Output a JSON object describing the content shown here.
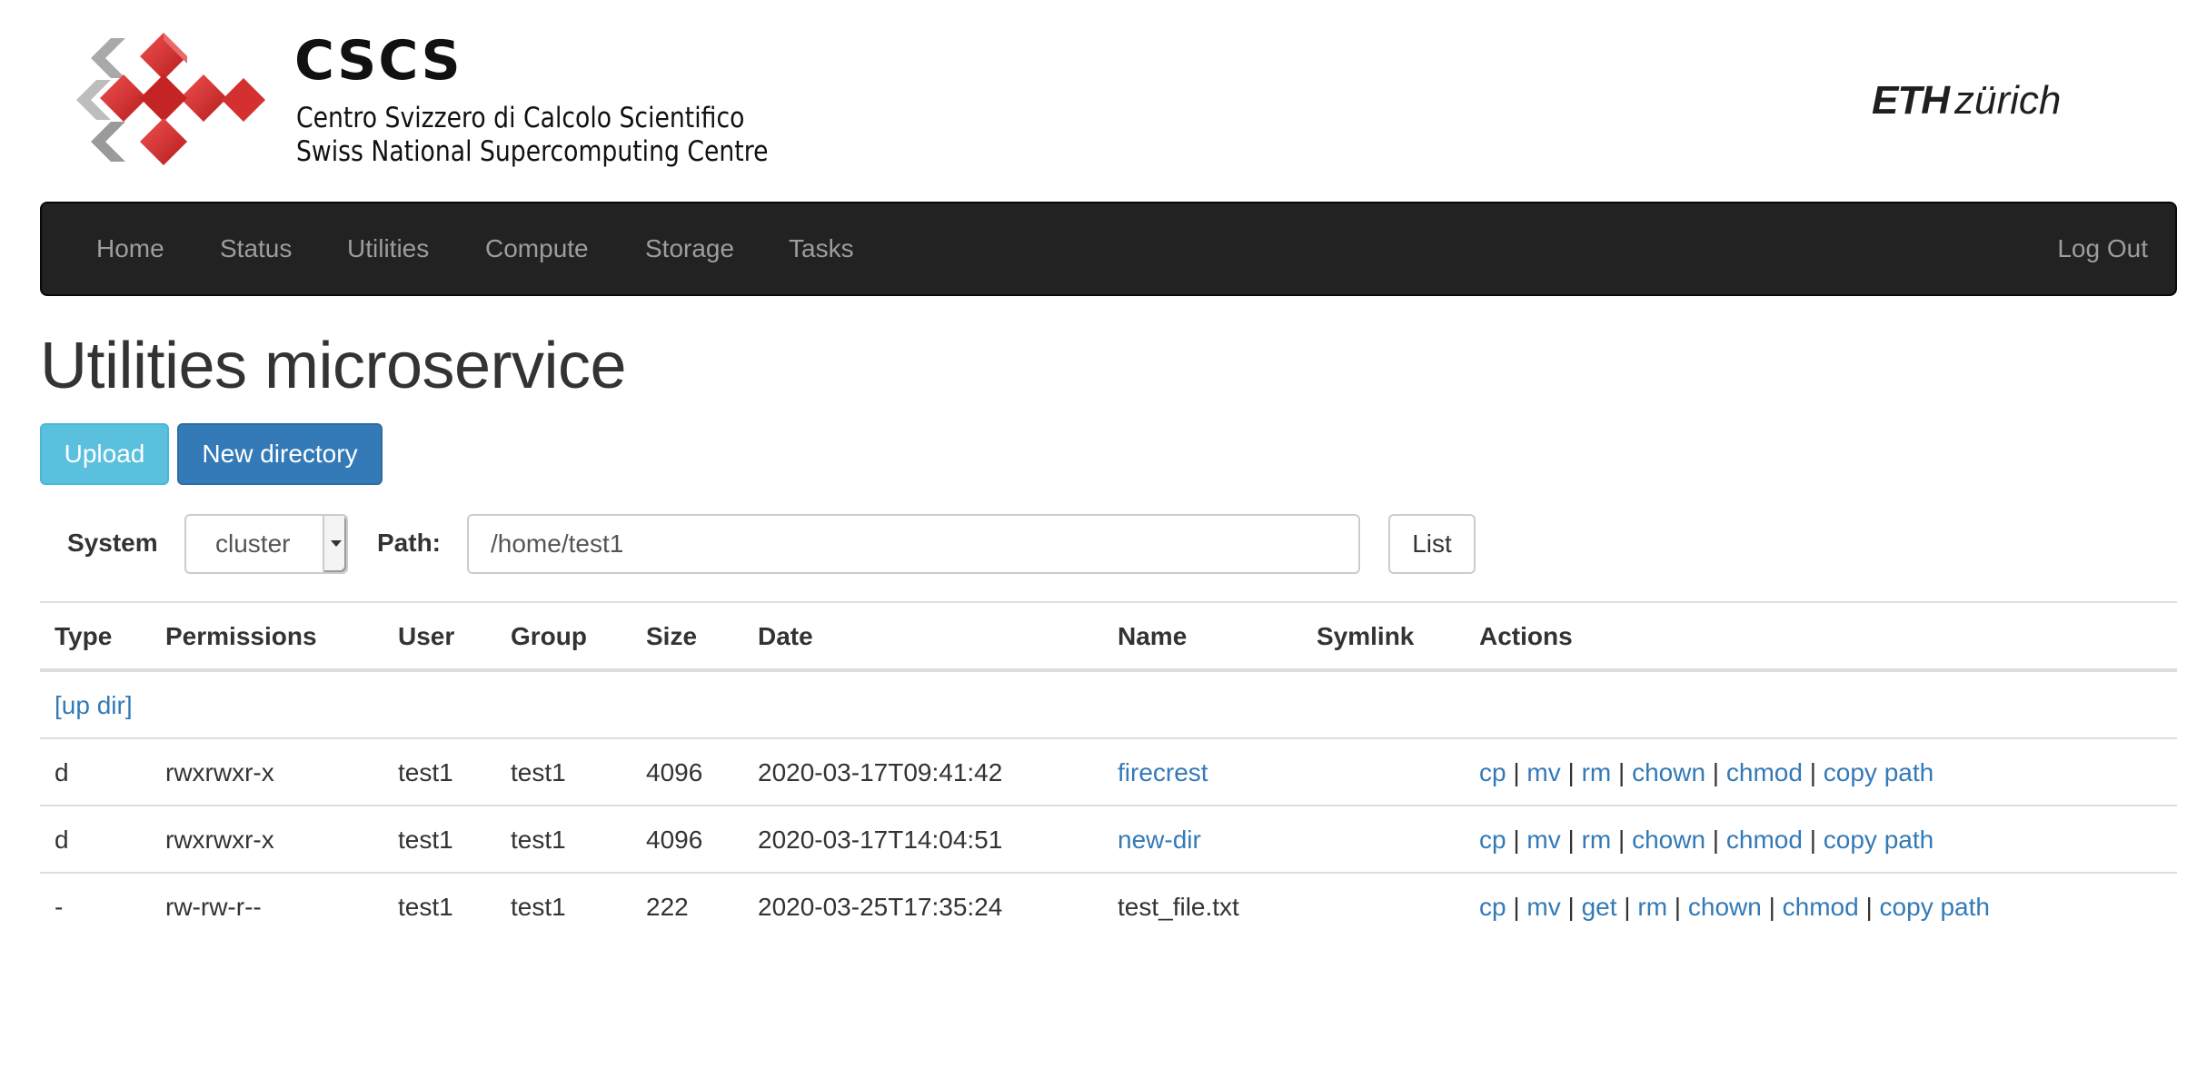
{
  "header": {
    "logo_title": "CSCS",
    "logo_line1": "Centro Svizzero di Calcolo Scientifico",
    "logo_line2": "Swiss National Supercomputing Centre",
    "eth_bold": "ETH",
    "eth_light": "zürich"
  },
  "nav": {
    "items": [
      "Home",
      "Status",
      "Utilities",
      "Compute",
      "Storage",
      "Tasks"
    ],
    "logout": "Log Out"
  },
  "page_title": "Utilities microservice",
  "buttons": {
    "upload": "Upload",
    "new_directory": "New directory",
    "list": "List"
  },
  "form": {
    "system_label": "System",
    "system_value": "cluster",
    "path_label": "Path:",
    "path_value": "/home/test1"
  },
  "table": {
    "headers": [
      "Type",
      "Permissions",
      "User",
      "Group",
      "Size",
      "Date",
      "Name",
      "Symlink",
      "Actions"
    ],
    "up_dir": "[up dir]",
    "rows": [
      {
        "type": "d",
        "permissions": "rwxrwxr-x",
        "user": "test1",
        "group": "test1",
        "size": "4096",
        "date": "2020-03-17T09:41:42",
        "name": "firecrest",
        "name_is_link": true,
        "symlink": "",
        "actions": [
          "cp",
          "mv",
          "rm",
          "chown",
          "chmod",
          "copy path"
        ]
      },
      {
        "type": "d",
        "permissions": "rwxrwxr-x",
        "user": "test1",
        "group": "test1",
        "size": "4096",
        "date": "2020-03-17T14:04:51",
        "name": "new-dir",
        "name_is_link": true,
        "symlink": "",
        "actions": [
          "cp",
          "mv",
          "rm",
          "chown",
          "chmod",
          "copy path"
        ]
      },
      {
        "type": "-",
        "permissions": "rw-rw-r--",
        "user": "test1",
        "group": "test1",
        "size": "222",
        "date": "2020-03-25T17:35:24",
        "name": "test_file.txt",
        "name_is_link": false,
        "symlink": "",
        "actions": [
          "cp",
          "mv",
          "get",
          "rm",
          "chown",
          "chmod",
          "copy path"
        ]
      }
    ]
  },
  "colors": {
    "link": "#337ab7",
    "navbar": "#222222",
    "upload": "#5bc0de",
    "primary": "#337ab7",
    "logo_red": "#d32a2a"
  }
}
